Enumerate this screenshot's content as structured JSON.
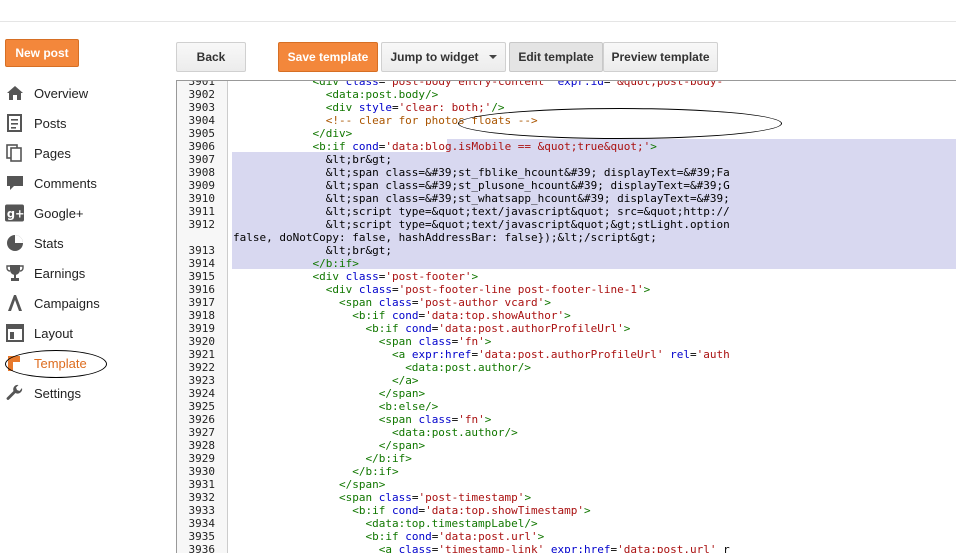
{
  "header": {
    "new_post_label": "New post"
  },
  "sidebar": {
    "items": [
      {
        "label": "Overview",
        "icon": "home-icon"
      },
      {
        "label": "Posts",
        "icon": "posts-icon"
      },
      {
        "label": "Pages",
        "icon": "pages-icon"
      },
      {
        "label": "Comments",
        "icon": "comments-icon"
      },
      {
        "label": "Google+",
        "icon": "google-plus-icon"
      },
      {
        "label": "Stats",
        "icon": "stats-icon"
      },
      {
        "label": "Earnings",
        "icon": "trophy-icon"
      },
      {
        "label": "Campaigns",
        "icon": "campaigns-icon"
      },
      {
        "label": "Layout",
        "icon": "layout-icon"
      },
      {
        "label": "Template",
        "icon": "template-icon",
        "active": true
      },
      {
        "label": "Settings",
        "icon": "wrench-icon"
      }
    ]
  },
  "toolbar": {
    "back_label": "Back",
    "save_label": "Save template",
    "jump_label": "Jump to widget",
    "edit_label": "Edit template",
    "preview_label": "Preview template"
  },
  "editor": {
    "line_numbers": [
      "3901",
      "3902",
      "3903",
      "3904",
      "3905",
      "3906",
      "3907",
      "3908",
      "3909",
      "3910",
      "3911",
      "3912",
      "",
      "3913",
      "3914",
      "3915",
      "3916",
      "3917",
      "3918",
      "3919",
      "3920",
      "3921",
      "3922",
      "3923",
      "3924",
      "3925",
      "3926",
      "3927",
      "3928",
      "3929",
      "3930",
      "3931",
      "3932",
      "3933",
      "3934",
      "3935",
      "3936"
    ],
    "lines": [
      "            <div class='post-body entry-content' expr:id='&quot;post-body-",
      "              <data:post.body/>",
      "              <div style='clear: both;'/>",
      "              <!-- clear for photos floats -->",
      "            </div>",
      "            <b:if cond='data:blog.isMobile == &quot;true&quot;'>",
      "              &lt;br&gt;",
      "              &lt;span class=&#39;st_fblike_hcount&#39; displayText=&#39;Fa",
      "              &lt;span class=&#39;st_plusone_hcount&#39; displayText=&#39;G",
      "              &lt;span class=&#39;st_whatsapp_hcount&#39; displayText=&#39;",
      "              &lt;script type=&quot;text/javascript&quot; src=&quot;http://",
      "              &lt;script type=&quot;text/javascript&quot;&gt;stLight.option",
      "false, doNotCopy: false, hashAddressBar: false});&lt;/script&gt;",
      "              &lt;br&gt;",
      "            </b:if>",
      "            <div class='post-footer'>",
      "              <div class='post-footer-line post-footer-line-1'>",
      "                <span class='post-author vcard'>",
      "                  <b:if cond='data:top.showAuthor'>",
      "                    <b:if cond='data:post.authorProfileUrl'>",
      "                      <span class='fn'>",
      "                        <a expr:href='data:post.authorProfileUrl' rel='auth",
      "                          <data:post.author/>",
      "                        </a>",
      "                      </span>",
      "                      <b:else/>",
      "                      <span class='fn'>",
      "                        <data:post.author/>",
      "                      </span>",
      "                    </b:if>",
      "                  </b:if>",
      "                </span>",
      "                <span class='post-timestamp'>",
      "                  <b:if cond='data:top.showTimestamp'>",
      "                    <data:top.timestampLabel/>",
      "                    <b:if cond='data:post.url'>",
      "                      <a class='timestamp-link' expr:href='data:post.url' r"
    ]
  }
}
